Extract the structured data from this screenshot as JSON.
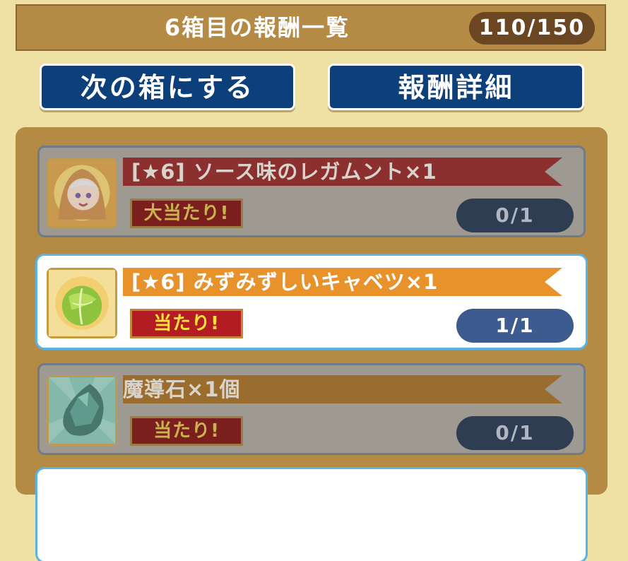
{
  "header": {
    "title": "6箱目の報酬一覧",
    "counter": "110/150"
  },
  "buttons": {
    "next_box": "次の箱にする",
    "reward_detail": "報酬詳細"
  },
  "rewards": [
    {
      "name": "[★6] ソース味のレガムント×1",
      "badge": "大当たり!",
      "progress": "0/1",
      "state": "dim",
      "icon": "character-portrait-icon",
      "ribbon_color": "#8c2f2f"
    },
    {
      "name": "[★6] みずみずしいキャベツ×1",
      "badge": "当たり!",
      "progress": "1/1",
      "state": "active",
      "icon": "cabbage-icon",
      "ribbon_color": "#e8922c"
    },
    {
      "name": "魔導石×1個",
      "badge": "当たり!",
      "progress": "0/1",
      "state": "dim",
      "icon": "magic-stone-icon",
      "ribbon_color": "#9a6d2f"
    }
  ],
  "colors": {
    "background": "#efe0a3",
    "header_bar": "#b58a45",
    "button_blue": "#0d3f7a",
    "badge_red": "#b31c22",
    "badge_text": "#ffe23a"
  }
}
